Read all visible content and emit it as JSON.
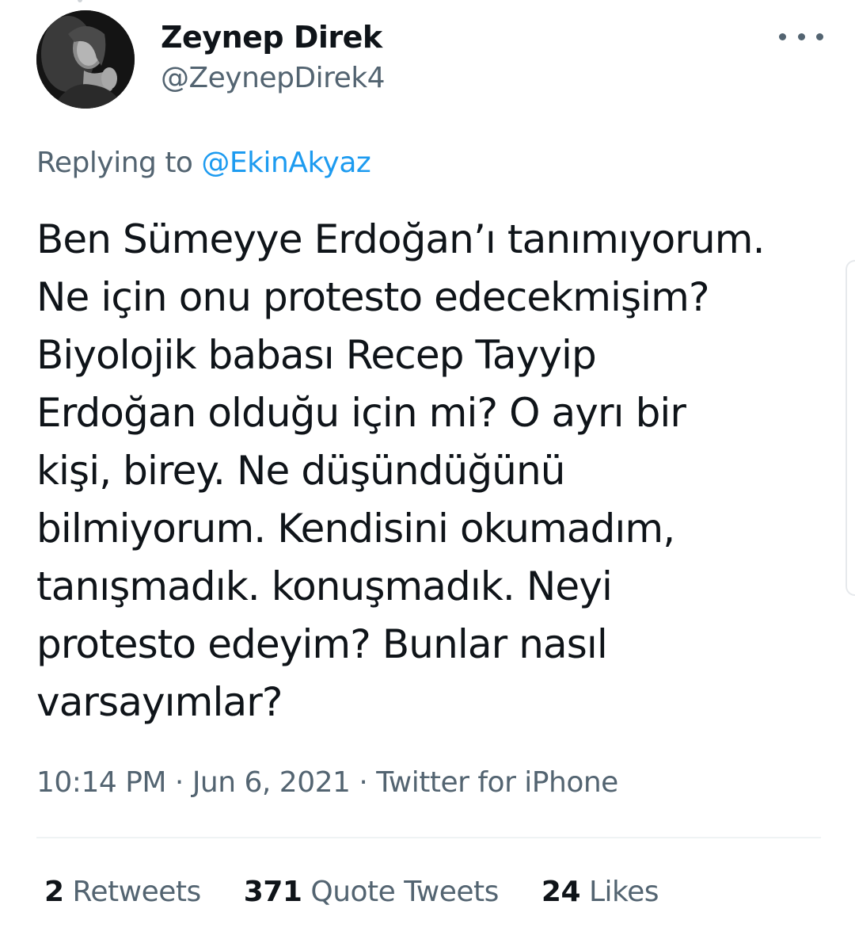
{
  "author": {
    "display_name": "Zeynep Direk",
    "handle": "@ZeynepDirek4",
    "avatar_icon": "profile-photo"
  },
  "reply": {
    "prefix": "Replying to ",
    "mention": "@EkinAkyaz"
  },
  "tweet": {
    "lines": [
      "Ben Sümeyye Erdoğan’ı tanımıyorum.",
      "Ne için onu protesto edecekmişim?",
      "Biyolojik babası Recep Tayyip",
      "Erdoğan olduğu için mi? O ayrı bir",
      "kişi, birey. Ne düşündüğünü",
      "bilmiyorum. Kendisini okumadım,",
      "tanışmadık. konuşmadık. Neyi",
      "protesto edeyim? Bunlar nasıl",
      "varsayımlar?"
    ]
  },
  "meta": {
    "time": "10:14 PM",
    "separator": " · ",
    "date": "Jun 6, 2021",
    "source": "Twitter for iPhone"
  },
  "stats": {
    "retweets_count": "2",
    "retweets_label": " Retweets",
    "quotes_count": "371",
    "quotes_label": " Quote Tweets",
    "likes_count": "24",
    "likes_label": " Likes"
  },
  "colors": {
    "primary_text": "#0f1419",
    "secondary_text": "#536471",
    "link": "#1d9bf0",
    "divider": "#eff3f4"
  }
}
